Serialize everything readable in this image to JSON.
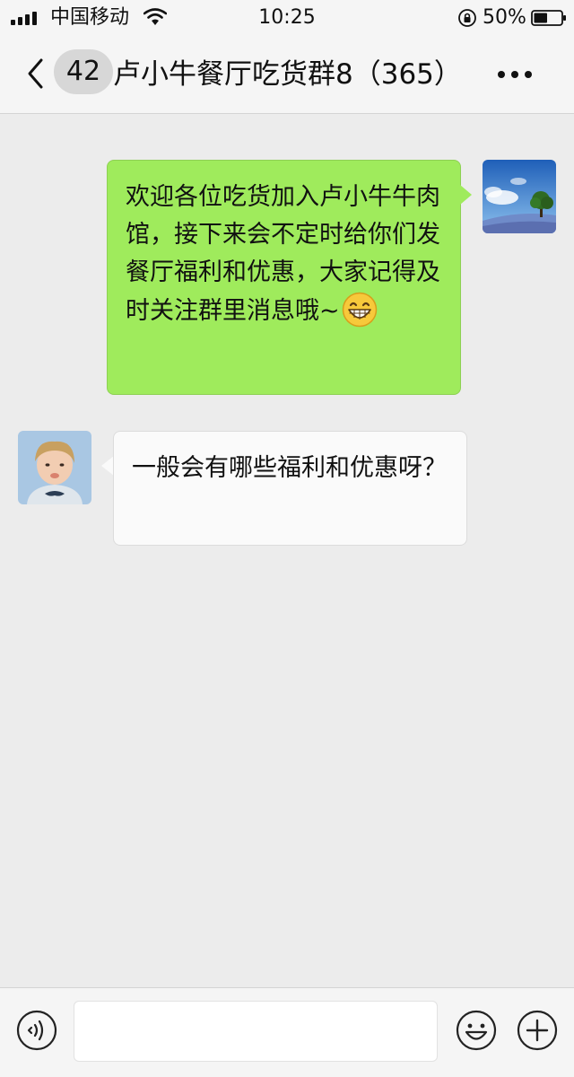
{
  "status_bar": {
    "carrier": "中国移动",
    "time": "10:25",
    "battery_percent": "50%",
    "battery_level": 0.5,
    "signal_icon": "signal-bars-icon",
    "wifi_icon": "wifi-icon",
    "lock_icon": "orientation-lock-icon"
  },
  "header": {
    "unread_count": "42",
    "title": "卢小牛餐厅吃货群8（365）",
    "back_icon": "chevron-left-icon",
    "more_icon": "more-dots-icon"
  },
  "messages": [
    {
      "sender": "self",
      "text": "欢迎各位吃货加入卢小牛牛肉馆，接下来会不定时给你们发餐厅福利和优惠，大家记得及时关注群里消息哦~",
      "emoji": "grinning-face-icon"
    },
    {
      "sender": "other",
      "text": "一般会有哪些福利和优惠呀？"
    }
  ],
  "input_bar": {
    "voice_icon": "voice-icon",
    "emoji_icon": "emoji-icon",
    "plus_icon": "plus-circle-icon",
    "input_value": ""
  },
  "colors": {
    "background": "#ececec",
    "self_bubble": "#9feb5c",
    "other_bubble": "#fafafa",
    "bar": "#f5f5f5"
  }
}
